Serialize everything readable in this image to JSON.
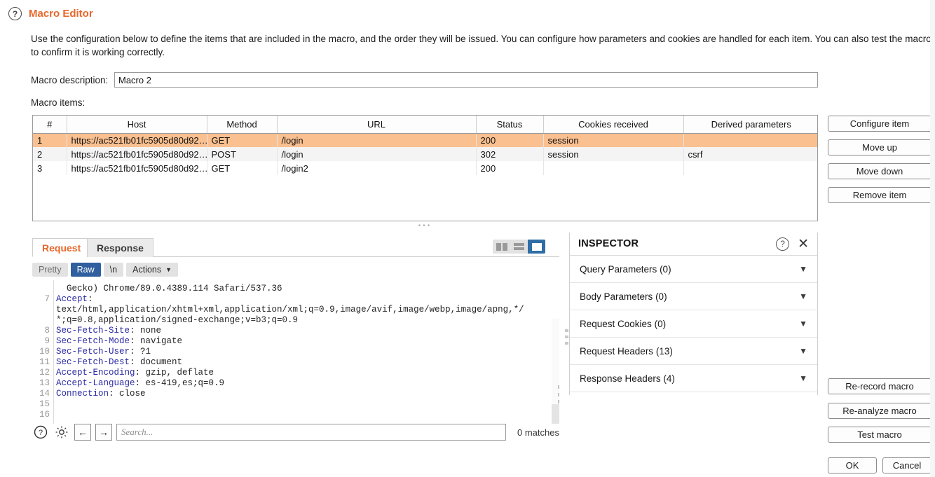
{
  "header": {
    "help_icon": "help-icon",
    "title": "Macro Editor",
    "description": "Use the configuration below to define the items that are included in the macro, and the order they will be issued. You can configure how parameters and cookies are handled for each item. You can also test the macro to confirm it is working correctly."
  },
  "macro": {
    "description_label": "Macro description:",
    "description_value": "Macro 2",
    "items_label": "Macro items:"
  },
  "table": {
    "columns": [
      "#",
      "Host",
      "Method",
      "URL",
      "Status",
      "Cookies received",
      "Derived parameters"
    ],
    "rows": [
      {
        "num": "1",
        "host": "https://ac521fb01fc5905d80d92…",
        "method": "GET",
        "url": "/login",
        "status": "200",
        "cookies": "session",
        "derived": ""
      },
      {
        "num": "2",
        "host": "https://ac521fb01fc5905d80d92…",
        "method": "POST",
        "url": "/login",
        "status": "302",
        "cookies": "session",
        "derived": "csrf"
      },
      {
        "num": "3",
        "host": "https://ac521fb01fc5905d80d92…",
        "method": "GET",
        "url": "/login2",
        "status": "200",
        "cookies": "",
        "derived": ""
      }
    ],
    "selected_row_index": 0,
    "selection_color": "#fac090"
  },
  "item_buttons": [
    {
      "label": "Configure item"
    },
    {
      "label": "Move up"
    },
    {
      "label": "Move down"
    },
    {
      "label": "Remove item"
    }
  ],
  "macro_buttons": [
    {
      "label": "Re-record macro"
    },
    {
      "label": "Re-analyze macro"
    },
    {
      "label": "Test macro"
    }
  ],
  "dialog_buttons": {
    "ok": "OK",
    "cancel": "Cancel"
  },
  "message_panel": {
    "tabs": [
      {
        "label": "Request",
        "active": true
      },
      {
        "label": "Response",
        "active": false
      }
    ],
    "view_controls": [
      {
        "label": "Pretty",
        "active": false
      },
      {
        "label": "Raw",
        "active": true
      },
      {
        "label": "\\n",
        "active": false
      },
      {
        "label": "Actions",
        "active": false,
        "caret": "⌄"
      }
    ],
    "layout_toggle": {
      "options": [
        "side-by-side-icon",
        "stacked-icon",
        "single-pane-icon"
      ],
      "selected_index": 2
    },
    "code_lines": [
      {
        "num": "",
        "segments": [
          {
            "t": "  Gecko) Chrome/89.0.4389.114 Safari/537.36",
            "k": false
          }
        ]
      },
      {
        "num": "7",
        "segments": [
          {
            "t": "Accept",
            "k": true
          },
          {
            "t": ":",
            "k": false
          }
        ]
      },
      {
        "num": "",
        "segments": [
          {
            "t": "text/html,application/xhtml+xml,application/xml;q=0.9,image/avif,image/webp,image/apng,*/",
            "k": false
          }
        ]
      },
      {
        "num": "",
        "segments": [
          {
            "t": "*;q=0.8,application/signed-exchange;v=b3;q=0.9",
            "k": false
          }
        ]
      },
      {
        "num": "8",
        "segments": [
          {
            "t": "Sec-Fetch-Site",
            "k": true
          },
          {
            "t": ": none",
            "k": false
          }
        ]
      },
      {
        "num": "9",
        "segments": [
          {
            "t": "Sec-Fetch-Mode",
            "k": true
          },
          {
            "t": ": navigate",
            "k": false
          }
        ]
      },
      {
        "num": "10",
        "segments": [
          {
            "t": "Sec-Fetch-User",
            "k": true
          },
          {
            "t": ": ?1",
            "k": false
          }
        ]
      },
      {
        "num": "11",
        "segments": [
          {
            "t": "Sec-Fetch-Dest",
            "k": true
          },
          {
            "t": ": document",
            "k": false
          }
        ]
      },
      {
        "num": "12",
        "segments": [
          {
            "t": "Accept-Encoding",
            "k": true
          },
          {
            "t": ": gzip, deflate",
            "k": false
          }
        ]
      },
      {
        "num": "13",
        "segments": [
          {
            "t": "Accept-Language",
            "k": true
          },
          {
            "t": ": es-419,es;q=0.9",
            "k": false
          }
        ]
      },
      {
        "num": "14",
        "segments": [
          {
            "t": "Connection",
            "k": true
          },
          {
            "t": ": close",
            "k": false
          }
        ]
      },
      {
        "num": "15",
        "segments": [
          {
            "t": "",
            "k": false
          }
        ]
      },
      {
        "num": "16",
        "segments": [
          {
            "t": "",
            "k": false
          }
        ]
      }
    ],
    "search": {
      "help_icon": "help-icon",
      "settings_icon": "gear-icon",
      "prev_icon": "←",
      "next_icon": "→",
      "placeholder": "Search...",
      "value": "",
      "matches": "0 matches"
    }
  },
  "inspector": {
    "title": "INSPECTOR",
    "help_icon": "help-icon",
    "close_icon": "close-icon",
    "sections": [
      {
        "label": "Query Parameters",
        "count": "(0)"
      },
      {
        "label": "Body Parameters",
        "count": "(0)"
      },
      {
        "label": "Request Cookies",
        "count": "(0)"
      },
      {
        "label": "Request Headers",
        "count": "(13)"
      },
      {
        "label": "Response Headers",
        "count": "(4)"
      }
    ],
    "chevron": "⌄"
  },
  "colors": {
    "accent": "#e8672b",
    "selection": "#fac090",
    "toggle_active": "#2f5f9e",
    "header_keyword": "#2a2aa5"
  }
}
